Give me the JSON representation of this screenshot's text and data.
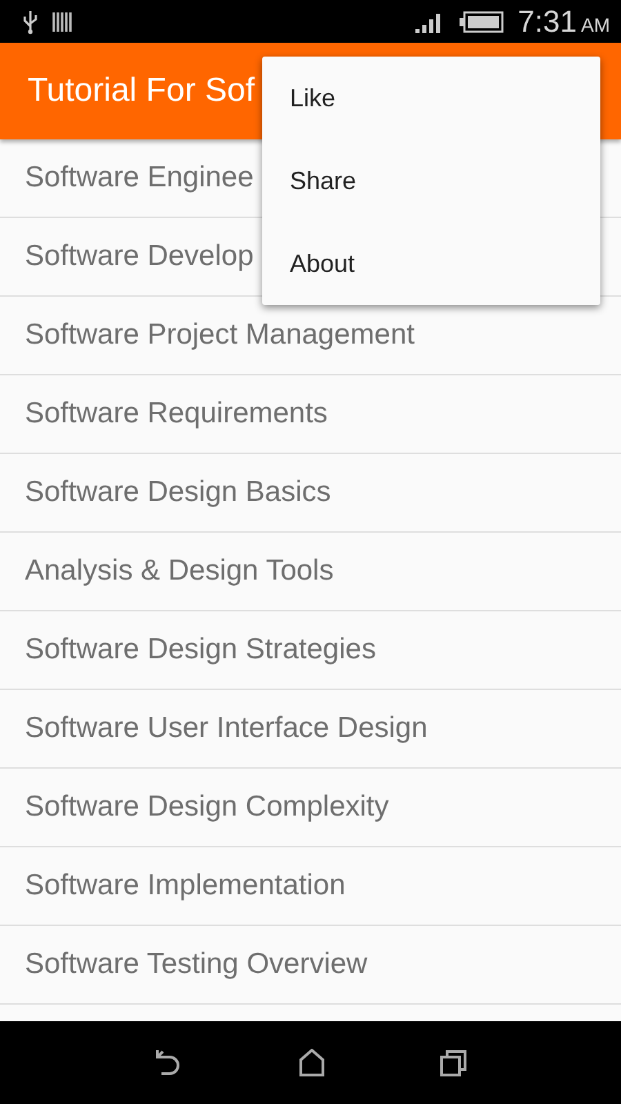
{
  "status_bar": {
    "time": "7:31",
    "meridiem": "AM"
  },
  "app_bar": {
    "title": "Tutorial For Sof"
  },
  "menu": {
    "items": [
      {
        "label": "Like"
      },
      {
        "label": "Share"
      },
      {
        "label": "About"
      }
    ]
  },
  "list": {
    "items": [
      {
        "label": "Software Enginee"
      },
      {
        "label": "Software Develop"
      },
      {
        "label": "Software Project Management"
      },
      {
        "label": "Software Requirements"
      },
      {
        "label": "Software Design Basics"
      },
      {
        "label": "Analysis & Design Tools"
      },
      {
        "label": "Software Design Strategies"
      },
      {
        "label": "Software User Interface Design"
      },
      {
        "label": "Software Design Complexity"
      },
      {
        "label": "Software Implementation"
      },
      {
        "label": "Software Testing Overview"
      }
    ]
  }
}
